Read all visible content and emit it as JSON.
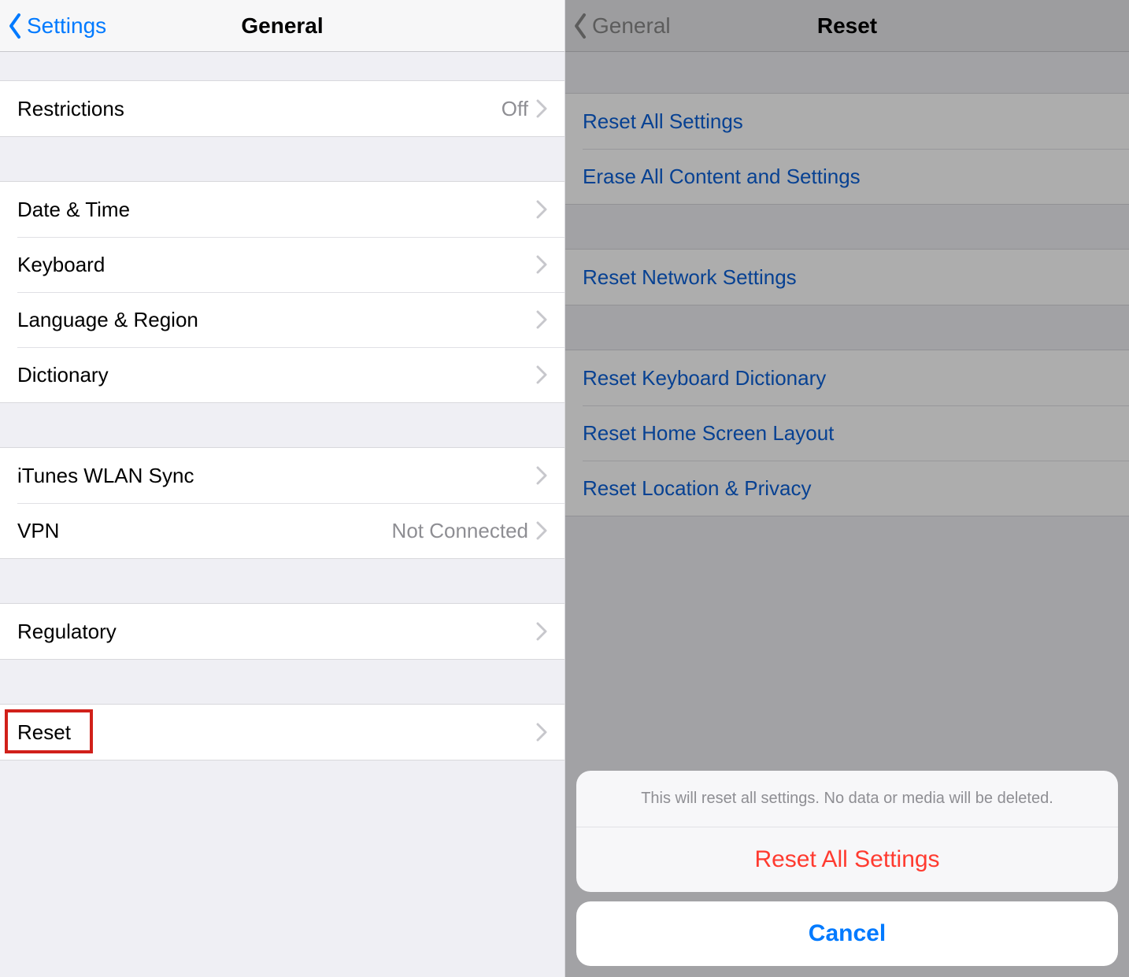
{
  "left": {
    "back_label": "Settings",
    "title": "General",
    "groups": [
      {
        "rows": [
          {
            "label": "Restrictions",
            "value": "Off"
          }
        ]
      },
      {
        "rows": [
          {
            "label": "Date & Time"
          },
          {
            "label": "Keyboard"
          },
          {
            "label": "Language & Region"
          },
          {
            "label": "Dictionary"
          }
        ]
      },
      {
        "rows": [
          {
            "label": "iTunes WLAN Sync"
          },
          {
            "label": "VPN",
            "value": "Not Connected"
          }
        ]
      },
      {
        "rows": [
          {
            "label": "Regulatory"
          }
        ]
      },
      {
        "rows": [
          {
            "label": "Reset",
            "highlighted": true
          }
        ]
      }
    ]
  },
  "right": {
    "back_label": "General",
    "title": "Reset",
    "groups": [
      {
        "rows": [
          {
            "label": "Reset All Settings"
          },
          {
            "label": "Erase All Content and Settings"
          }
        ]
      },
      {
        "rows": [
          {
            "label": "Reset Network Settings"
          }
        ]
      },
      {
        "rows": [
          {
            "label": "Reset Keyboard Dictionary"
          },
          {
            "label": "Reset Home Screen Layout"
          },
          {
            "label": "Reset Location & Privacy"
          }
        ]
      }
    ],
    "sheet": {
      "message": "This will reset all settings. No data or media will be deleted.",
      "action": "Reset All Settings",
      "cancel": "Cancel"
    }
  }
}
